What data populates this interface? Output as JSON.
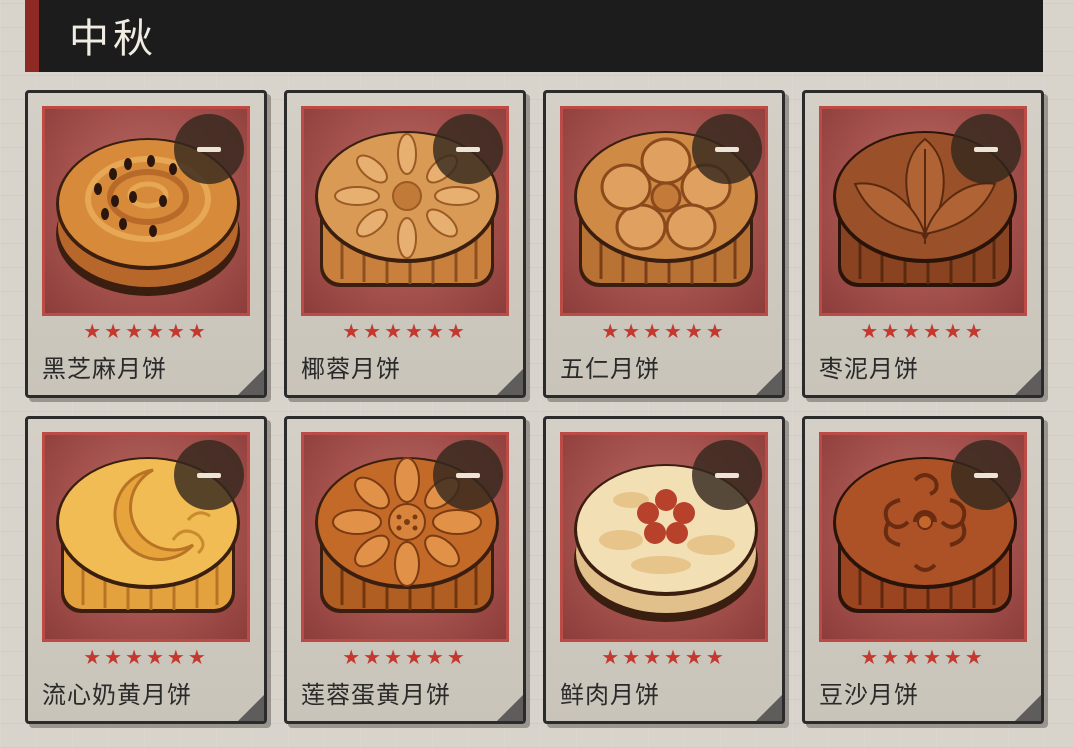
{
  "header": {
    "title": "中秋"
  },
  "items": [
    {
      "name": "黑芝麻月饼",
      "stars": "★★★★★★",
      "icon": "black-sesame-mooncake-icon"
    },
    {
      "name": "椰蓉月饼",
      "stars": "★★★★★★",
      "icon": "coconut-mooncake-icon"
    },
    {
      "name": "五仁月饼",
      "stars": "★★★★★★",
      "icon": "five-nut-mooncake-icon"
    },
    {
      "name": "枣泥月饼",
      "stars": "★★★★★★",
      "icon": "jujube-paste-mooncake-icon"
    },
    {
      "name": "流心奶黄月饼",
      "stars": "★★★★★★",
      "icon": "custard-lava-mooncake-icon"
    },
    {
      "name": "莲蓉蛋黄月饼",
      "stars": "★★★★★★",
      "icon": "lotus-yolk-mooncake-icon"
    },
    {
      "name": "鲜肉月饼",
      "stars": "★★★★★★",
      "icon": "fresh-meat-mooncake-icon"
    },
    {
      "name": "豆沙月饼",
      "stars": "★★★★★★",
      "icon": "red-bean-mooncake-icon"
    }
  ],
  "colors": {
    "header_bg": "#1c1c1c",
    "header_accent": "#8e2a23",
    "star": "#c4392f",
    "frame_border": "#bc4b45"
  }
}
